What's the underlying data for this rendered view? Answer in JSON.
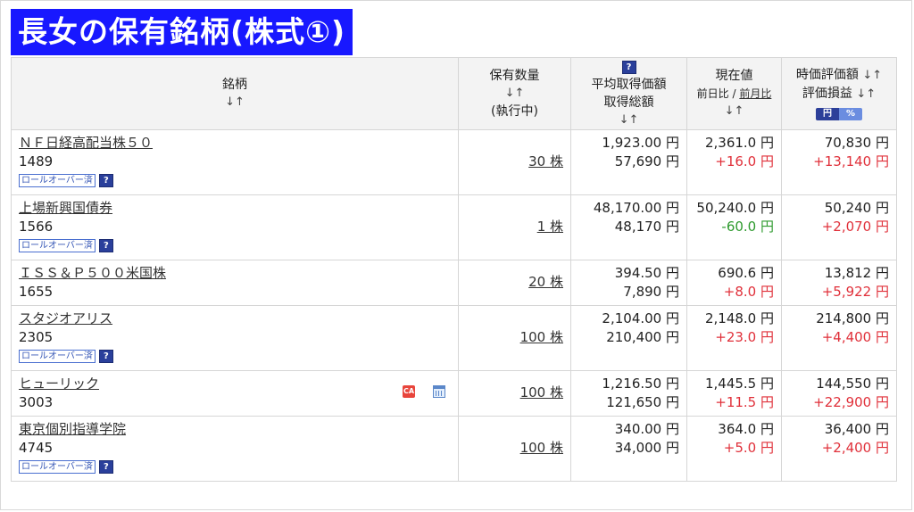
{
  "banner": {
    "title": "長女の保有銘柄(株式①)"
  },
  "header": {
    "name": "銘柄",
    "qty_line1": "保有数量",
    "qty_line3": "(執行中)",
    "avg_line1": "平均取得価額",
    "avg_line2": "取得総額",
    "price_line1": "現在値",
    "price_day": "前日比",
    "price_sep": " / ",
    "price_month": "前月比",
    "eval_line1": "時価評価額",
    "eval_line2": "評価損益",
    "toggle_yen": "円",
    "toggle_pct": "%",
    "sort_glyph": "↓↑",
    "help_glyph": "?"
  },
  "labels": {
    "rollover": "ロールオーバー済"
  },
  "holdings": [
    {
      "name": "ＮＦ日経高配当株５０",
      "code": "1489",
      "qty": "30 株",
      "avg_price": "1,923.00 円",
      "avg_total": "57,690 円",
      "price": "2,361.0 円",
      "price_change": "+16.0 円",
      "eval": "70,830 円",
      "eval_pl": "+13,140 円"
    },
    {
      "name": "上場新興国債券",
      "code": "1566",
      "qty": "1 株",
      "avg_price": "48,170.00 円",
      "avg_total": "48,170 円",
      "price": "50,240.0 円",
      "price_change": "-60.0 円",
      "eval": "50,240 円",
      "eval_pl": "+2,070 円"
    },
    {
      "name": "ＩＳＳ＆Ｐ５００米国株",
      "code": "1655",
      "qty": "20 株",
      "avg_price": "394.50 円",
      "avg_total": "7,890 円",
      "price": "690.6 円",
      "price_change": "+8.0 円",
      "eval": "13,812 円",
      "eval_pl": "+5,922 円"
    },
    {
      "name": "スタジオアリス",
      "code": "2305",
      "qty": "100 株",
      "avg_price": "2,104.00 円",
      "avg_total": "210,400 円",
      "price": "2,148.0 円",
      "price_change": "+23.0 円",
      "eval": "214,800 円",
      "eval_pl": "+4,400 円"
    },
    {
      "name": "ヒューリック",
      "code": "3003",
      "qty": "100 株",
      "avg_price": "1,216.50 円",
      "avg_total": "121,650 円",
      "price": "1,445.5 円",
      "price_change": "+11.5 円",
      "eval": "144,550 円",
      "eval_pl": "+22,900 円",
      "ca_badge": "CA"
    },
    {
      "name": "東京個別指導学院",
      "code": "4745",
      "qty": "100 株",
      "avg_price": "340.00 円",
      "avg_total": "34,000 円",
      "price": "364.0 円",
      "price_change": "+5.0 円",
      "eval": "36,400 円",
      "eval_pl": "+2,400 円"
    }
  ],
  "colors": {
    "banner": "#1818ff",
    "gain": "#e0303a",
    "loss": "#2e9a2e",
    "toggle_on": "#2c3f99"
  }
}
